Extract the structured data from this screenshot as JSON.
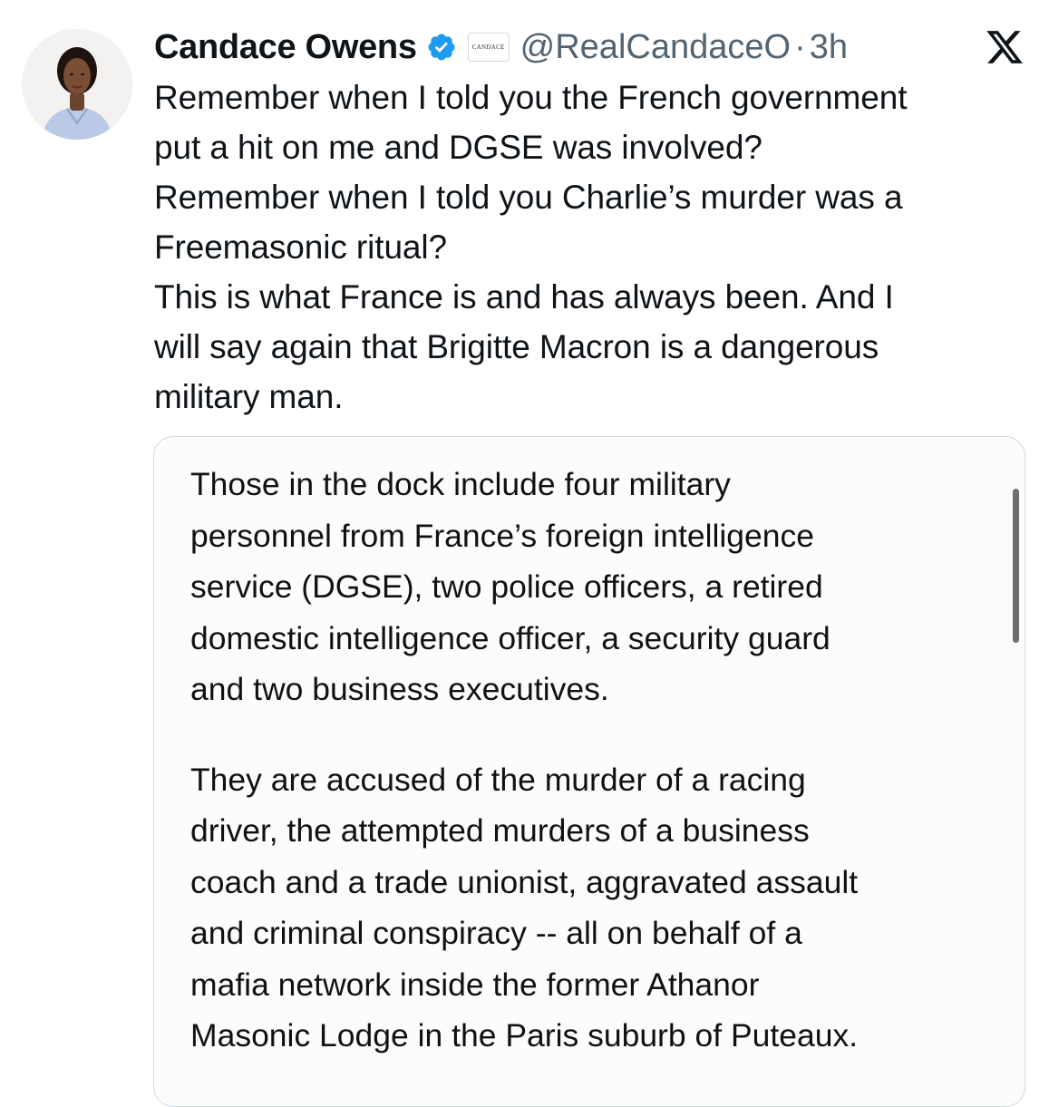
{
  "tweet": {
    "author_name": "Candace Owens",
    "affiliate_badge_text": "CANDACE",
    "handle": "@RealCandaceO",
    "separator": "·",
    "time": "3h",
    "verified_icon": "verified-badge-icon",
    "platform_icon": "x-logo-icon",
    "text_lines": [
      "Remember when I told you the French government\nput a hit on me and DGSE was involved?",
      "Remember when I told you Charlie’s murder was a\nFreemasonic ritual?",
      "This is what France is and has always been. And I\nwill say again that Brigitte Macron is a dangerous\nmilitary man."
    ]
  },
  "quoted_card": {
    "paragraphs": [
      "Those in the dock include four military\npersonnel from France’s foreign intelligence\nservice (DGSE), two police officers, a retired\ndomestic intelligence officer, a security guard\nand two business executives.",
      "They are accused of the murder of a racing\ndriver, the attempted murders of a business\ncoach and a trade unionist, aggravated assault\nand criminal conspiracy -- all on behalf of a\nmafia network inside the former Athanor\nMasonic Lodge in the Paris suburb of Puteaux."
    ]
  },
  "colors": {
    "verified_blue": "#1d9bf0",
    "secondary_text": "#536471",
    "border": "#cfd9de"
  }
}
